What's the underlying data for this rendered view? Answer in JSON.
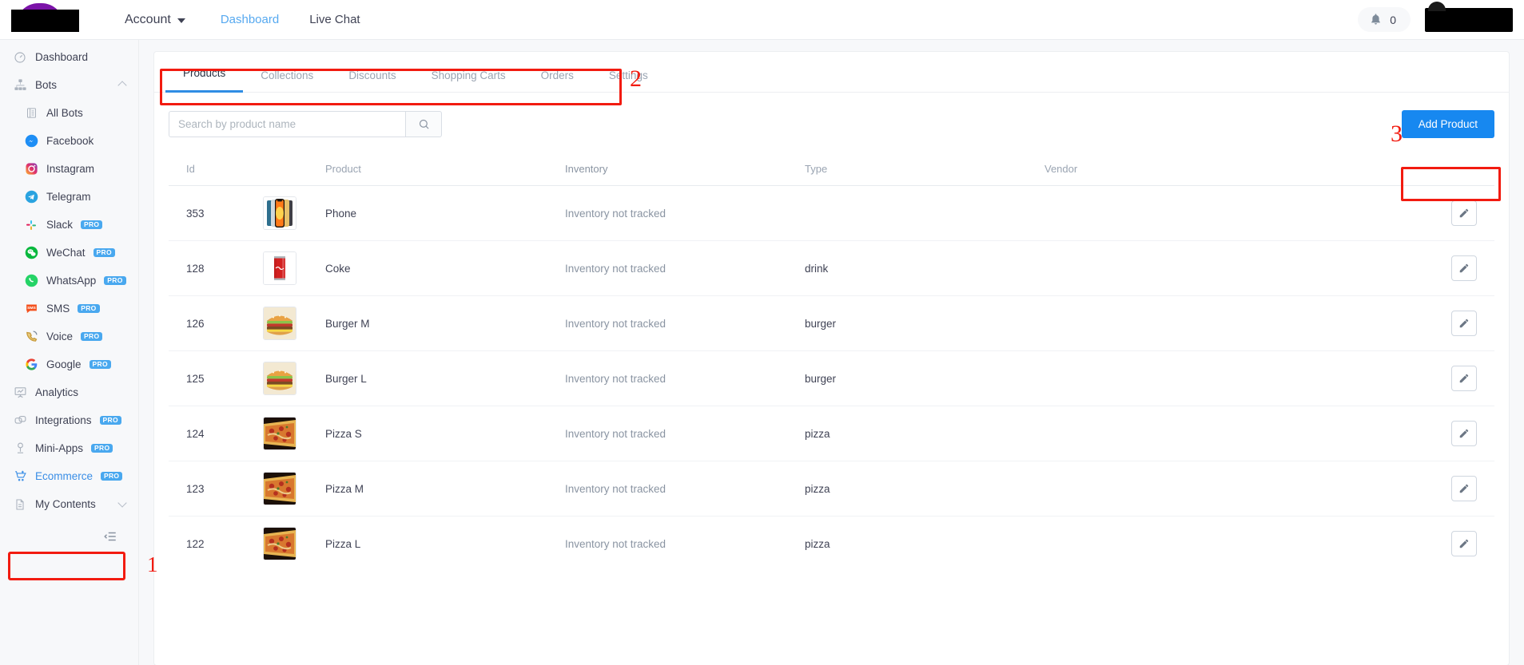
{
  "topbar": {
    "account_label": "Account",
    "nav": [
      {
        "label": "Dashboard",
        "active": true
      },
      {
        "label": "Live Chat",
        "active": false
      }
    ],
    "notification_count": "0"
  },
  "sidebar": {
    "items": [
      {
        "label": "Dashboard",
        "icon": "speedometer-icon",
        "pro": false,
        "sub": false
      },
      {
        "label": "Bots",
        "icon": "sitemap-icon",
        "pro": false,
        "sub": false,
        "chevron": "up"
      },
      {
        "label": "All Bots",
        "icon": "list-icon",
        "pro": false,
        "sub": true
      },
      {
        "label": "Facebook",
        "icon": "messenger-icon",
        "pro": false,
        "sub": true
      },
      {
        "label": "Instagram",
        "icon": "instagram-icon",
        "pro": false,
        "sub": true
      },
      {
        "label": "Telegram",
        "icon": "telegram-icon",
        "pro": false,
        "sub": true
      },
      {
        "label": "Slack",
        "icon": "slack-icon",
        "pro": true,
        "sub": true
      },
      {
        "label": "WeChat",
        "icon": "wechat-icon",
        "pro": true,
        "sub": true
      },
      {
        "label": "WhatsApp",
        "icon": "whatsapp-icon",
        "pro": true,
        "sub": true
      },
      {
        "label": "SMS",
        "icon": "sms-icon",
        "pro": true,
        "sub": true
      },
      {
        "label": "Voice",
        "icon": "phone-icon",
        "pro": true,
        "sub": true
      },
      {
        "label": "Google",
        "icon": "google-icon",
        "pro": true,
        "sub": true
      },
      {
        "label": "Analytics",
        "icon": "analytics-board-icon",
        "pro": false,
        "sub": false
      },
      {
        "label": "Integrations",
        "icon": "link-icon",
        "pro": true,
        "sub": false
      },
      {
        "label": "Mini-Apps",
        "icon": "person-icon",
        "pro": true,
        "sub": false
      },
      {
        "label": "Ecommerce",
        "icon": "cart-icon",
        "pro": true,
        "sub": false,
        "active": true
      },
      {
        "label": "My Contents",
        "icon": "document-icon",
        "pro": false,
        "sub": false,
        "chevron": "down"
      }
    ],
    "pro_badge_label": "PRO"
  },
  "annotations": [
    {
      "number": "1",
      "target": "sidebar-ecommerce"
    },
    {
      "number": "2",
      "target": "tabs-row"
    },
    {
      "number": "3",
      "target": "add-product-button"
    }
  ],
  "main": {
    "tabs": [
      {
        "label": "Products",
        "active": true
      },
      {
        "label": "Collections",
        "active": false
      },
      {
        "label": "Discounts",
        "active": false
      },
      {
        "label": "Shopping Carts",
        "active": false
      },
      {
        "label": "Orders",
        "active": false
      },
      {
        "label": "Settings",
        "active": false
      }
    ],
    "search": {
      "value": "",
      "placeholder": "Search by product name",
      "icon": "search-icon"
    },
    "add_product_label": "Add Product",
    "table": {
      "columns": [
        "Id",
        "",
        "Product",
        "Inventory",
        "Type",
        "Vendor",
        ""
      ],
      "headers": {
        "id": "Id",
        "product": "Product",
        "inventory": "Inventory",
        "type": "Type",
        "vendor": "Vendor"
      },
      "rows": [
        {
          "id": "353",
          "product": "Phone",
          "image": "phone-thumb",
          "inventory": "Inventory not tracked",
          "type": "",
          "vendor": "",
          "action_icon": "pencil-icon"
        },
        {
          "id": "128",
          "product": "Coke",
          "image": "coke-thumb",
          "inventory": "Inventory not tracked",
          "type": "drink",
          "vendor": "",
          "action_icon": "pencil-icon"
        },
        {
          "id": "126",
          "product": "Burger M",
          "image": "burger-thumb",
          "inventory": "Inventory not tracked",
          "type": "burger",
          "vendor": "",
          "action_icon": "pencil-icon"
        },
        {
          "id": "125",
          "product": "Burger L",
          "image": "burger-thumb",
          "inventory": "Inventory not tracked",
          "type": "burger",
          "vendor": "",
          "action_icon": "pencil-icon"
        },
        {
          "id": "124",
          "product": "Pizza S",
          "image": "pizza-thumb",
          "inventory": "Inventory not tracked",
          "type": "pizza",
          "vendor": "",
          "action_icon": "pencil-icon"
        },
        {
          "id": "123",
          "product": "Pizza M",
          "image": "pizza-thumb",
          "inventory": "Inventory not tracked",
          "type": "pizza",
          "vendor": "",
          "action_icon": "pencil-icon"
        },
        {
          "id": "122",
          "product": "Pizza L",
          "image": "pizza-thumb",
          "inventory": "Inventory not tracked",
          "type": "pizza",
          "vendor": "",
          "action_icon": "pencil-icon"
        }
      ]
    }
  },
  "colors": {
    "accent_blue": "#1788f0",
    "link_blue": "#3a8ee6",
    "annotation_red": "#f21b10",
    "pro_badge": "#49a8ef",
    "sidebar_bg": "#f7f8fa",
    "text_primary": "#3f4254",
    "text_muted": "#9aa4b2"
  }
}
